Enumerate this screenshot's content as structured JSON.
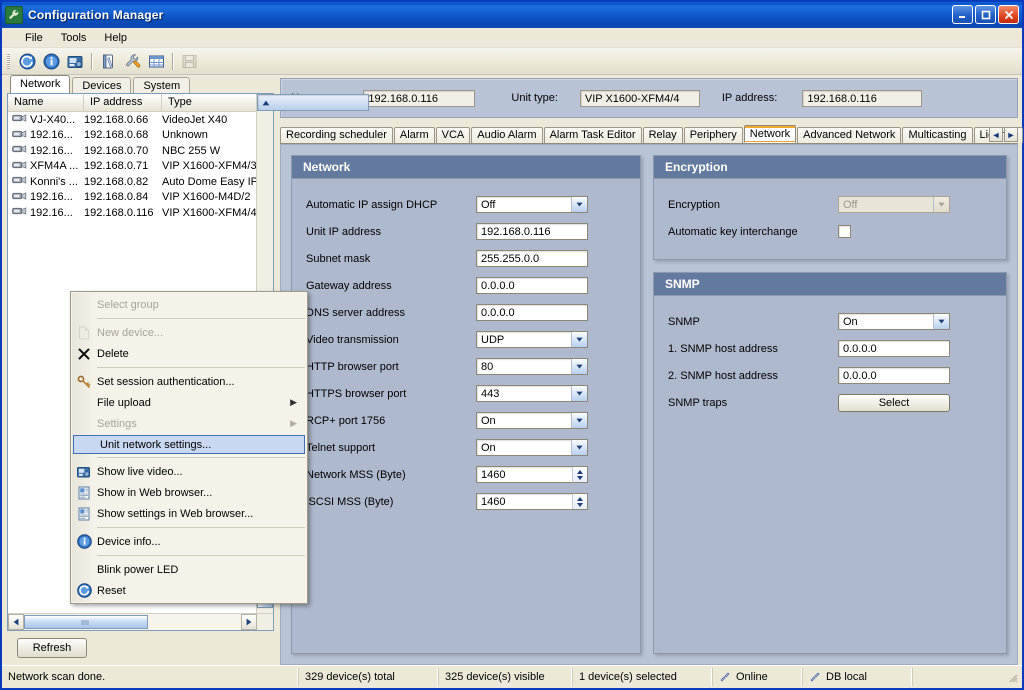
{
  "window": {
    "title": "Configuration Manager",
    "icon": "wrench-icon",
    "minimize_label": "_",
    "maximize_label": "□",
    "close_label": "×"
  },
  "menubar": {
    "items": [
      {
        "label": "File"
      },
      {
        "label": "Tools"
      },
      {
        "label": "Help"
      }
    ]
  },
  "toolbar": {
    "buttons": [
      {
        "icon": "refresh-icon",
        "enabled": true
      },
      {
        "icon": "info-icon",
        "enabled": true
      },
      {
        "icon": "live-video-icon",
        "enabled": true
      },
      {
        "icon": "notebook-icon",
        "enabled": true
      },
      {
        "icon": "wrench-icon",
        "enabled": true
      },
      {
        "icon": "table-icon",
        "enabled": true
      },
      {
        "icon": "save-icon",
        "enabled": false
      }
    ]
  },
  "left_pane": {
    "tabs": [
      {
        "label": "Network",
        "active": true
      },
      {
        "label": "Devices",
        "active": false
      },
      {
        "label": "System",
        "active": false
      }
    ],
    "columns": [
      "Name",
      "IP address",
      "Type"
    ],
    "rows": [
      {
        "name": "VJ-X40...",
        "ip": "192.168.0.66",
        "type": "VideoJet X40"
      },
      {
        "name": "192.16...",
        "ip": "192.168.0.68",
        "type": "Unknown"
      },
      {
        "name": "192.16...",
        "ip": "192.168.0.70",
        "type": "NBC 255 W"
      },
      {
        "name": "XFM4A ...",
        "ip": "192.168.0.71",
        "type": "VIP X1600-XFM4/3"
      },
      {
        "name": "Konni's ...",
        "ip": "192.168.0.82",
        "type": "Auto Dome Easy IP"
      },
      {
        "name": "192.16...",
        "ip": "192.168.0.84",
        "type": "VIP X1600-M4D/2"
      },
      {
        "name": "192.16...",
        "ip": "192.168.0.116",
        "type": "VIP X1600-XFM4/4"
      }
    ],
    "refresh_button": "Refresh"
  },
  "context_menu": {
    "items": [
      {
        "label": "Select group",
        "icon": null,
        "disabled": true,
        "selected": false,
        "submenu": false
      },
      {
        "separator": true
      },
      {
        "label": "New device...",
        "icon": "new-document-icon",
        "disabled": true,
        "selected": false,
        "submenu": false
      },
      {
        "label": "Delete",
        "icon": "delete-x-icon",
        "disabled": false,
        "selected": false,
        "submenu": false
      },
      {
        "separator": true
      },
      {
        "label": "Set session authentication...",
        "icon": "key-icon",
        "disabled": false,
        "selected": false,
        "submenu": false
      },
      {
        "label": "File upload",
        "icon": null,
        "disabled": false,
        "selected": false,
        "submenu": true
      },
      {
        "label": "Settings",
        "icon": null,
        "disabled": true,
        "selected": false,
        "submenu": true
      },
      {
        "label": "Unit network settings...",
        "icon": null,
        "disabled": false,
        "selected": true,
        "submenu": false
      },
      {
        "separator": true
      },
      {
        "label": "Show live video...",
        "icon": "live-video-icon",
        "disabled": false,
        "selected": false,
        "submenu": false
      },
      {
        "label": "Show in Web browser...",
        "icon": "web-page-icon",
        "disabled": false,
        "selected": false,
        "submenu": false
      },
      {
        "label": "Show settings in Web browser...",
        "icon": "web-page-icon",
        "disabled": false,
        "selected": false,
        "submenu": false
      },
      {
        "separator": true
      },
      {
        "label": "Device info...",
        "icon": "info-icon",
        "disabled": false,
        "selected": false,
        "submenu": false
      },
      {
        "separator": true
      },
      {
        "label": "Blink power LED",
        "icon": null,
        "disabled": false,
        "selected": false,
        "submenu": false
      },
      {
        "label": "Reset",
        "icon": "reset-icon",
        "disabled": false,
        "selected": false,
        "submenu": false
      }
    ]
  },
  "info_bar": {
    "name_label": "Name:",
    "name_value": "192.168.0.116",
    "unit_type_label": "Unit type:",
    "unit_type_value": "VIP X1600-XFM4/4",
    "ip_label": "IP address:",
    "ip_value": "192.168.0.116"
  },
  "content_tabs": {
    "items": [
      {
        "label": "Recording scheduler",
        "active": false
      },
      {
        "label": "Alarm",
        "active": false
      },
      {
        "label": "VCA",
        "active": false
      },
      {
        "label": "Audio Alarm",
        "active": false
      },
      {
        "label": "Alarm Task Editor",
        "active": false
      },
      {
        "label": "Relay",
        "active": false
      },
      {
        "label": "Periphery",
        "active": false
      },
      {
        "label": "Network",
        "active": true
      },
      {
        "label": "Advanced Network",
        "active": false
      },
      {
        "label": "Multicasting",
        "active": false
      },
      {
        "label": "License",
        "active": false
      }
    ],
    "nav_prev": "◄",
    "nav_next": "►"
  },
  "panels": {
    "network": {
      "title": "Network",
      "fields": [
        {
          "label": "Automatic IP assign DHCP",
          "type": "select",
          "value": "Off",
          "enabled": true
        },
        {
          "label": "Unit IP address",
          "type": "text",
          "value": "192.168.0.116",
          "enabled": true
        },
        {
          "label": "Subnet mask",
          "type": "text",
          "value": "255.255.0.0",
          "enabled": true
        },
        {
          "label": "Gateway address",
          "type": "text",
          "value": "0.0.0.0",
          "enabled": true
        },
        {
          "label": "DNS server address",
          "type": "text",
          "value": "0.0.0.0",
          "enabled": true
        },
        {
          "label": "Video transmission",
          "type": "select",
          "value": "UDP",
          "enabled": true
        },
        {
          "label": "HTTP browser port",
          "type": "select",
          "value": "80",
          "enabled": true
        },
        {
          "label": "HTTPS browser port",
          "type": "select",
          "value": "443",
          "enabled": true
        },
        {
          "label": "RCP+ port 1756",
          "type": "select",
          "value": "On",
          "enabled": true
        },
        {
          "label": "Telnet support",
          "type": "select",
          "value": "On",
          "enabled": true
        },
        {
          "label": "Network MSS (Byte)",
          "type": "spinner",
          "value": "1460",
          "enabled": true
        },
        {
          "label": "iSCSI MSS (Byte)",
          "type": "spinner",
          "value": "1460",
          "enabled": true
        }
      ]
    },
    "encryption": {
      "title": "Encryption",
      "fields": [
        {
          "label": "Encryption",
          "type": "select",
          "value": "Off",
          "enabled": false
        },
        {
          "label": "Automatic key interchange",
          "type": "checkbox",
          "value": false,
          "enabled": true
        }
      ]
    },
    "snmp": {
      "title": "SNMP",
      "fields": [
        {
          "label": "SNMP",
          "type": "select",
          "value": "On",
          "enabled": true
        },
        {
          "label": "1. SNMP host address",
          "type": "text",
          "value": "0.0.0.0",
          "enabled": true
        },
        {
          "label": "2. SNMP host address",
          "type": "text",
          "value": "0.0.0.0",
          "enabled": true
        },
        {
          "label": "SNMP traps",
          "type": "button",
          "value": "Select",
          "enabled": true
        }
      ]
    }
  },
  "status_bar": {
    "message": "Network scan done.",
    "total": "329 device(s) total",
    "visible": "325 device(s) visible",
    "selected": "1 device(s) selected",
    "online": "Online",
    "database": "DB local"
  },
  "colors": {
    "title_blue": "#0a54c8",
    "panel_bg": "#b8c3d6",
    "group_bg": "#aeb9cd",
    "group_head": "#64799e",
    "chrome": "#ece9d8",
    "selection": "#c7d8f0",
    "tab_accent": "#f0a830"
  }
}
